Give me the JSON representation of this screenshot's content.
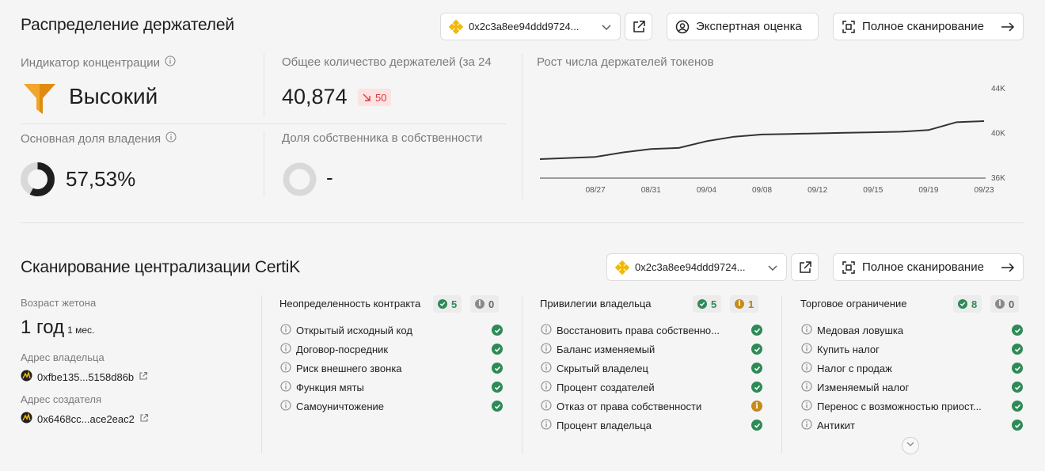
{
  "holders": {
    "title": "Распределение держателей",
    "contract_short": "0x2c3a8ee94ddd9724...",
    "expert_label": "Экспертная оценка",
    "full_scan_label": "Полное сканирование",
    "concentration_label": "Индикатор концентрации",
    "concentration_value": "Высокий",
    "total_holders_label": "Общее количество держателей (за 24",
    "total_holders_value": "40,874",
    "total_holders_change": "50",
    "main_share_label": "Основная доля владения",
    "main_share_value": "57,53%",
    "main_share_fraction": 0.5753,
    "owner_share_label": "Доля собственника в собственности",
    "owner_share_value": "-"
  },
  "chart_data": {
    "type": "line",
    "title": "Рост числа держателей токенов",
    "x": [
      "08/23",
      "08/25",
      "08/27",
      "08/29",
      "08/31",
      "09/02",
      "09/04",
      "09/06",
      "09/08",
      "09/10",
      "09/12",
      "09/14",
      "09/15",
      "09/17",
      "09/19",
      "09/21",
      "09/23"
    ],
    "tick_labels": [
      "08/27",
      "08/31",
      "09/04",
      "09/08",
      "09/12",
      "09/15",
      "09/19",
      "09/23"
    ],
    "y_ticks": [
      "44K",
      "40K",
      "36K"
    ],
    "ylim": [
      36000,
      44000
    ],
    "series": [
      {
        "values": [
          37700,
          37800,
          37900,
          38300,
          38600,
          38700,
          39300,
          39700,
          39900,
          39950,
          40000,
          40050,
          40100,
          40150,
          40300,
          41000,
          41100
        ]
      }
    ],
    "color": "#333333"
  },
  "certik": {
    "title": "Сканирование централизации CertiK",
    "contract_short": "0x2c3a8ee94ddd9724...",
    "full_scan_label": "Полное сканирование",
    "age_label": "Возраст жетона",
    "age_value": "1 год",
    "age_suffix": "1 мес.",
    "owner_label": "Адрес владельца",
    "owner_addr": "0xfbe135...5158d86b",
    "creator_label": "Адрес создателя",
    "creator_addr": "0x6468cc...ace2eac2",
    "columns": [
      {
        "title": "Неопределенность контракта",
        "ok": "5",
        "other": "0",
        "other_kind": "info",
        "items": [
          {
            "name": "Открытый исходный код",
            "status": "ok"
          },
          {
            "name": "Договор-посредник",
            "status": "ok"
          },
          {
            "name": "Риск внешнего звонка",
            "status": "ok"
          },
          {
            "name": "Функция мяты",
            "status": "ok"
          },
          {
            "name": "Самоуничтожение",
            "status": "ok"
          }
        ]
      },
      {
        "title": "Привилегии владельца",
        "ok": "5",
        "other": "1",
        "other_kind": "warn",
        "items": [
          {
            "name": "Восстановить права собственно...",
            "status": "ok"
          },
          {
            "name": "Баланс изменяемый",
            "status": "ok"
          },
          {
            "name": "Скрытый владелец",
            "status": "ok"
          },
          {
            "name": "Процент создателей",
            "status": "ok"
          },
          {
            "name": "Отказ от права собственности",
            "status": "warn"
          },
          {
            "name": "Процент владельца",
            "status": "ok"
          }
        ]
      },
      {
        "title": "Торговое ограничение",
        "ok": "8",
        "other": "0",
        "other_kind": "info",
        "items": [
          {
            "name": "Медовая ловушка",
            "status": "ok"
          },
          {
            "name": "Купить налог",
            "status": "ok"
          },
          {
            "name": "Налог с продаж",
            "status": "ok"
          },
          {
            "name": "Изменяемый налог",
            "status": "ok"
          },
          {
            "name": "Перенос с возможностью приост...",
            "status": "ok"
          },
          {
            "name": "Антикит",
            "status": "ok"
          }
        ]
      }
    ]
  }
}
